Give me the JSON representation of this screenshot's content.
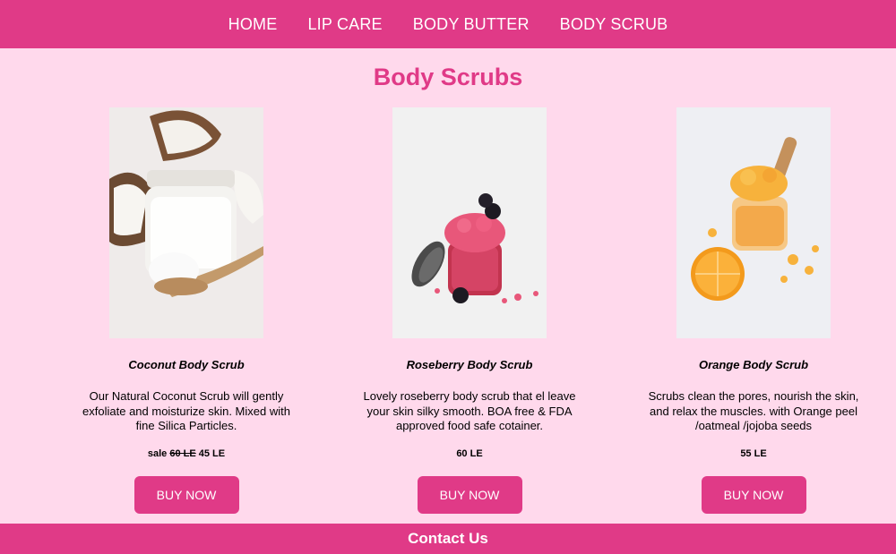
{
  "nav": {
    "items": [
      {
        "label": "HOME"
      },
      {
        "label": "LIP CARE"
      },
      {
        "label": "BODY BUTTER"
      },
      {
        "label": "BODY SCRUB"
      }
    ]
  },
  "page": {
    "title": "Body Scrubs"
  },
  "products": [
    {
      "name": "Coconut Body Scrub",
      "description": "Our Natural Coconut Scrub will gently exfoliate and moisturize skin. Mixed with fine Silica Particles.",
      "sale_label": "sale",
      "old_price": "60 LE",
      "price": "45 LE",
      "button": "BUY NOW",
      "image": "coconut-scrub-photo"
    },
    {
      "name": "Roseberry Body Scrub",
      "description": "Lovely roseberry body scrub that el leave your skin silky smooth. BOA free & FDA approved food safe cotainer.",
      "price": "60 LE",
      "button": "BUY NOW",
      "image": "roseberry-scrub-photo"
    },
    {
      "name": "Orange Body Scrub",
      "description": "Scrubs clean the pores, nourish the skin, and relax the muscles. with Orange peel /oatmeal /jojoba seeds",
      "price": "55 LE",
      "button": "BUY NOW",
      "image": "orange-scrub-photo"
    }
  ],
  "footer": {
    "label": "Contact Us"
  },
  "colors": {
    "accent": "#e03a87",
    "background": "#ffd9ec"
  }
}
